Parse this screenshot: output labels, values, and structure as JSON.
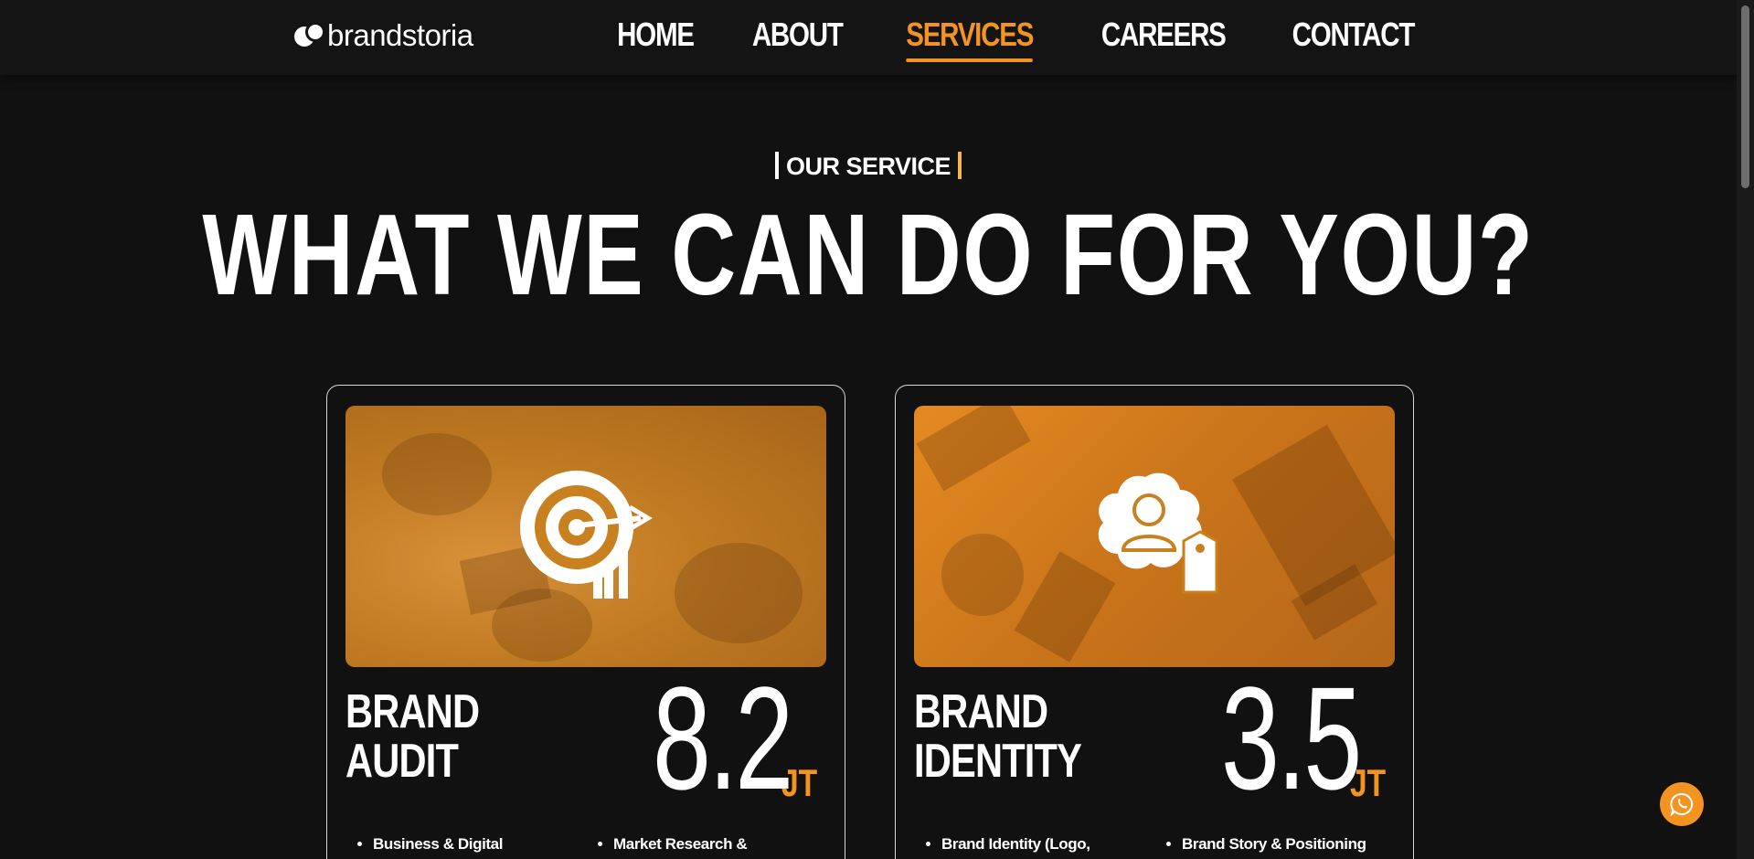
{
  "brand": {
    "name": "brandstoria"
  },
  "nav": {
    "items": [
      {
        "label": "HOME",
        "active": false
      },
      {
        "label": "ABOUT",
        "active": false
      },
      {
        "label": "SERVICES",
        "active": true
      },
      {
        "label": "CAREERS",
        "active": false
      },
      {
        "label": "CONTACT",
        "active": false
      }
    ]
  },
  "section": {
    "eyebrow": "OUR SERVICE",
    "heading": "WHAT WE CAN DO FOR YOU?"
  },
  "cards": [
    {
      "title_line1": "BRAND",
      "title_line2": "AUDIT",
      "price": "8.2",
      "unit": "JT",
      "icon": "target-icon",
      "features_left": [
        "Business & Digital"
      ],
      "features_right": [
        "Market Research &"
      ]
    },
    {
      "title_line1": "BRAND",
      "title_line2": "IDENTITY",
      "price": "3.5",
      "unit": "JT",
      "icon": "brand-identity-icon",
      "features_left": [
        "Brand Identity (Logo,"
      ],
      "features_right": [
        "Brand Story & Positioning"
      ]
    }
  ],
  "colors": {
    "accent": "#f39321",
    "background": "#111111"
  },
  "floating": {
    "icon": "whatsapp-icon"
  }
}
